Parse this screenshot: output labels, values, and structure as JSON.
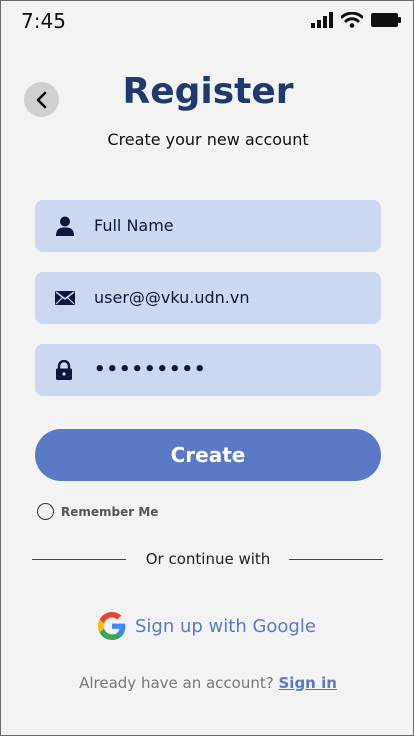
{
  "status_bar": {
    "time": "7:45",
    "icons": [
      "signal-icon",
      "wifi-icon",
      "battery-icon"
    ]
  },
  "header": {
    "back_icon": "chevron-left-icon",
    "title": "Register",
    "subtitle": "Create your new account"
  },
  "form": {
    "full_name": {
      "icon": "user-icon",
      "value": "Full Name"
    },
    "email": {
      "icon": "mail-icon",
      "value": "user@@vku.udn.vn"
    },
    "password": {
      "icon": "lock-icon",
      "value": "•••••••••"
    }
  },
  "create_button": {
    "label": "Create"
  },
  "remember_me": {
    "label": "Remember Me",
    "checked": false
  },
  "divider": {
    "label": "Or continue with"
  },
  "google": {
    "icon": "google-logo-icon",
    "label": "Sign up with Google"
  },
  "signin": {
    "prompt": "Already have an account?",
    "link": "Sign in"
  },
  "colors": {
    "accent": "#5a7ac6",
    "title": "#1f3a6e",
    "field_bg": "#ccd7f0",
    "background": "#f3f3f3"
  }
}
